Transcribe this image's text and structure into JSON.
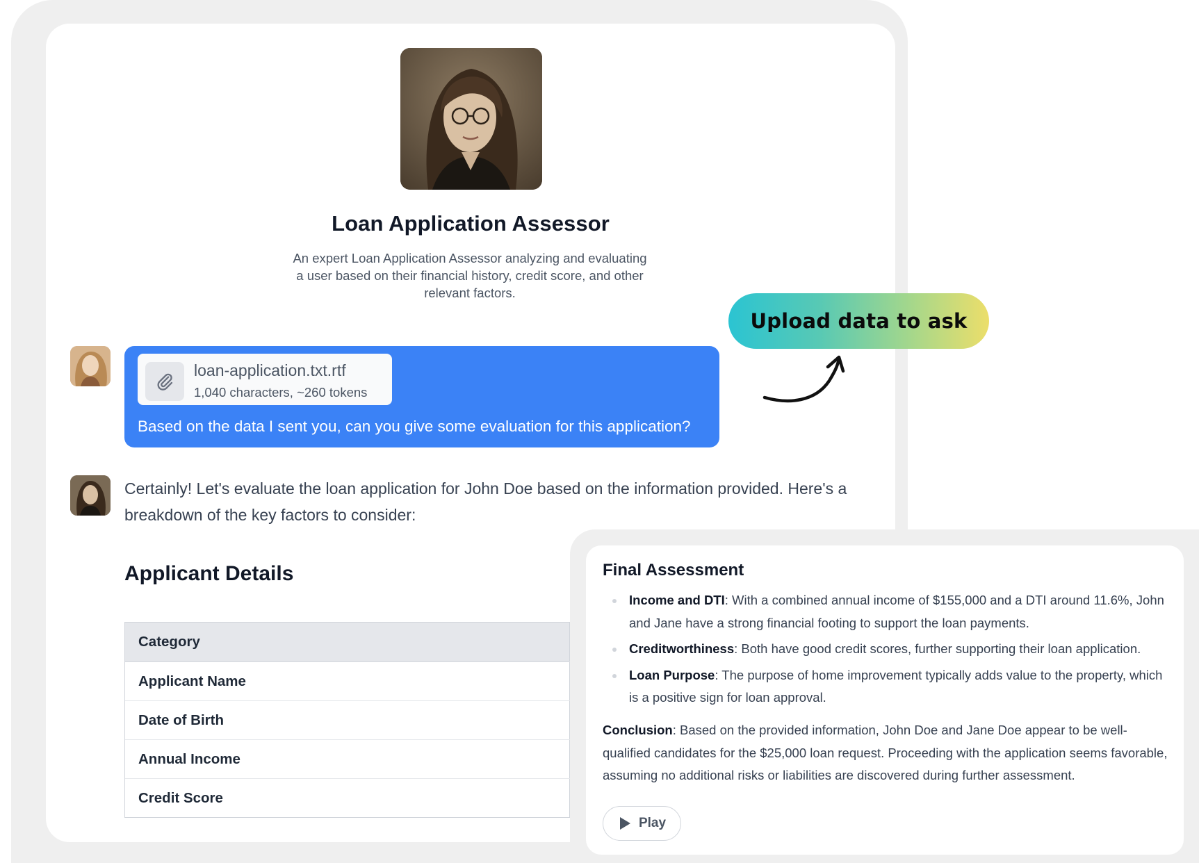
{
  "assistant": {
    "name": "Loan Application Assessor",
    "description": "An expert Loan Application Assessor analyzing and evaluating a user based on their financial history, credit score, and other relevant factors."
  },
  "user_message": {
    "attachment_name": "loan-application.txt.rtf",
    "attachment_meta": "1,040 characters, ~260 tokens",
    "text": "Based on the data I sent you, can you give some evaluation for this application?"
  },
  "assistant_message": {
    "intro": "Certainly! Let's evaluate the loan application for John Doe based on the information provided. Here's a breakdown of the key factors to consider:",
    "section_heading": "Applicant Details",
    "table": {
      "header": "Category",
      "rows": [
        "Applicant Name",
        "Date of Birth",
        "Annual Income",
        "Credit Score"
      ]
    }
  },
  "cta": {
    "label": "Upload data to ask"
  },
  "final_assessment": {
    "title": "Final Assessment",
    "items": [
      {
        "label": "Income and DTI",
        "text": ": With a combined annual income of $155,000 and a DTI around 11.6%, John and Jane have a strong financial footing to support the loan payments."
      },
      {
        "label": "Creditworthiness",
        "text": ": Both have good credit scores, further supporting their loan application."
      },
      {
        "label": "Loan Purpose",
        "text": ": The purpose of home improvement typically adds value to the property, which is a positive sign for loan approval."
      }
    ],
    "conclusion_label": "Conclusion",
    "conclusion_text": ": Based on the provided information, John Doe and Jane Doe appear to be well-qualified candidates for the $25,000 loan request. Proceeding with the application seems favorable, assuming no additional risks or liabilities are discovered during further assessment.",
    "play_label": "Play"
  },
  "colors": {
    "user_bubble": "#3b82f6",
    "cta_gradient_start": "#2bc4d2",
    "cta_gradient_end": "#ecde6a",
    "frame_gray": "#efefef"
  },
  "icons": {
    "attachment": "paperclip-icon",
    "play": "play-icon",
    "arrow": "curved-arrow-icon"
  }
}
